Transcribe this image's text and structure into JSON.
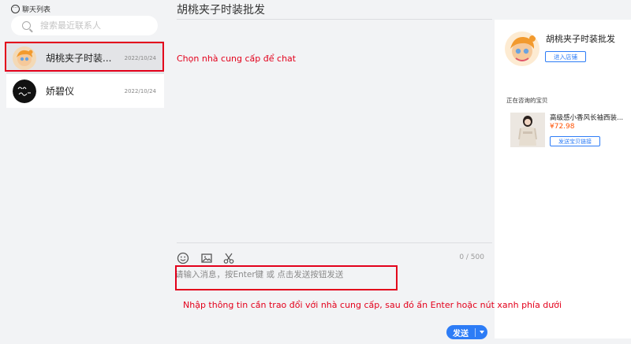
{
  "sidebar": {
    "header_label": "聊天列表",
    "search_placeholder": "搜索最近联系人",
    "contacts": [
      {
        "name": "胡桃夹子时装...",
        "date": "2022/10/24"
      },
      {
        "name": "娇碧仪",
        "date": "2022/10/24"
      }
    ]
  },
  "main": {
    "title": "胡桃夹子时装批发",
    "counter": "0 / 500",
    "input_placeholder": "请输入消息，按Enter键 或 点击发送按钮发送",
    "send_label": "发送"
  },
  "shop": {
    "name": "胡桃夹子时装批发",
    "enter_store_label": "进入店铺",
    "consulting_header": "正在咨询的宝贝",
    "product": {
      "title": "高级感小香风长袖西装...",
      "price": "¥72.98",
      "send_link_label": "发送宝贝链接"
    }
  },
  "annotations": {
    "contact_note": "Chọn nhà cung cấp để chat",
    "input_note": "Nhập thông tin cần trao đổi với nhà cung cấp, sau đó ấn Enter hoặc nút xanh phía dưới"
  },
  "colors": {
    "accent": "#2d7cf6",
    "annotation": "#e3001b",
    "price": "#ff5000"
  },
  "icons": [
    "chat-bubble-icon",
    "search-icon",
    "emoji-icon",
    "image-icon",
    "scissors-icon",
    "caret-down-icon"
  ]
}
